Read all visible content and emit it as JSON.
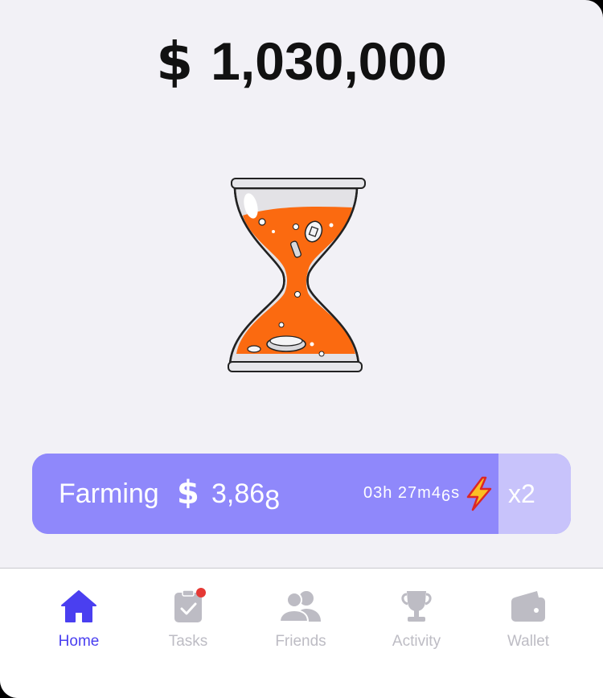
{
  "balance": {
    "currency_symbol": "$",
    "amount": "1,030,000"
  },
  "farming": {
    "label": "Farming",
    "currency_symbol": "$",
    "amount_main": "3,86",
    "amount_sub": "8",
    "timer_main": "03h 27m4",
    "timer_sub": "6",
    "timer_end": "s",
    "multiplier": "x2"
  },
  "nav": {
    "items": [
      {
        "label": "Home",
        "icon": "home-icon",
        "active": true
      },
      {
        "label": "Tasks",
        "icon": "tasks-icon",
        "active": false,
        "badge": true
      },
      {
        "label": "Friends",
        "icon": "friends-icon",
        "active": false
      },
      {
        "label": "Activity",
        "icon": "trophy-icon",
        "active": false
      },
      {
        "label": "Wallet",
        "icon": "wallet-icon",
        "active": false
      }
    ]
  },
  "colors": {
    "background": "#f2f1f6",
    "accent": "#4a3ff0",
    "farm_bar": "#8f88fb",
    "farm_multiplier": "#c8c3fb",
    "sand": "#fb6a10",
    "nav_inactive": "#bdbcc4",
    "badge": "#e53935"
  }
}
